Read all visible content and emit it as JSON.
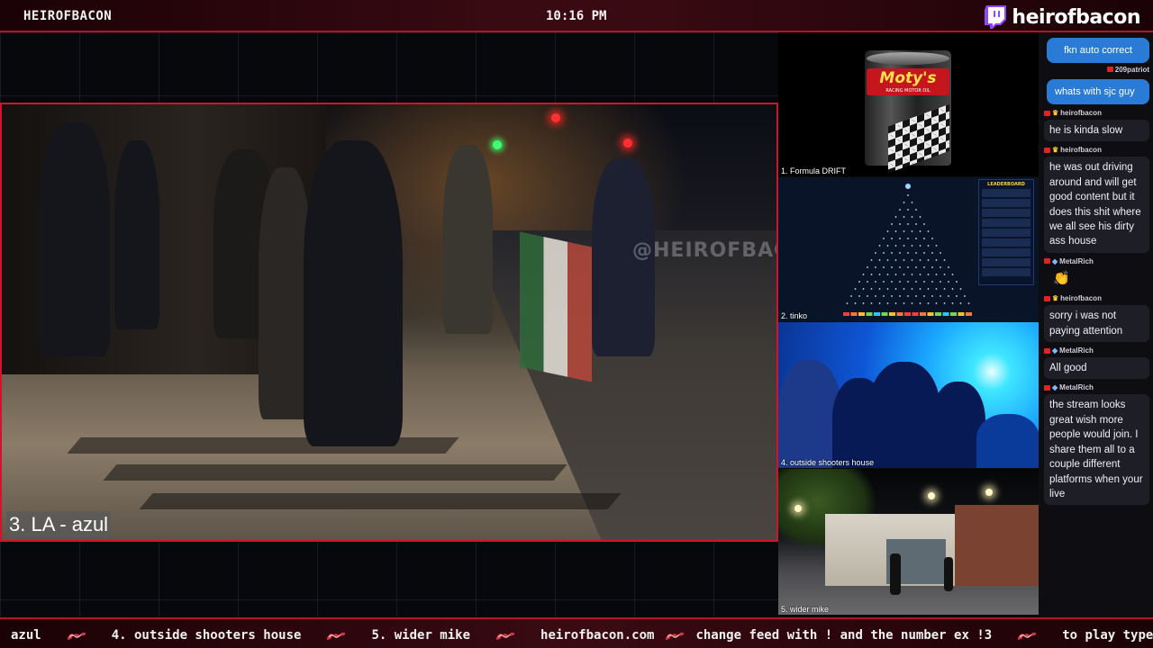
{
  "topbar": {
    "channel": "HEIROFBACON",
    "clock": "10:16 PM",
    "brand": "heirofbacon"
  },
  "main_feed": {
    "label": "3. LA - azul",
    "watermark": "@HEIROFBACON"
  },
  "feeds": [
    {
      "label": "1. Formula DRIFT",
      "oil_brand": "Moty's",
      "oil_sub": "RACING MOTOR OIL"
    },
    {
      "label": "2. tinko",
      "leaderboard_title": "LEADERBOARD"
    },
    {
      "label": "4. outside shooters house"
    },
    {
      "label": "5. wider mike"
    }
  ],
  "chat": {
    "messages": [
      {
        "author": "",
        "text": "fkn auto correct",
        "style": "outgoing"
      },
      {
        "author": "209patriot",
        "text": "",
        "style": "author-only"
      },
      {
        "author": "",
        "text": "whats with sjc guy",
        "style": "outgoing"
      },
      {
        "author": "heirofbacon",
        "text": "he is kinda slow",
        "badge": "crown"
      },
      {
        "author": "heirofbacon",
        "text": "he was out driving around and will get good content but it does this shit where we all see his dirty ass house",
        "badge": "crown"
      },
      {
        "author": "MetalRich",
        "text": "👏",
        "badge": "shield",
        "emoji": true
      },
      {
        "author": "heirofbacon",
        "text": "sorry i was not paying attention",
        "badge": "crown"
      },
      {
        "author": "MetalRich",
        "text": "All good",
        "badge": "shield"
      },
      {
        "author": "MetalRich",
        "text": "the stream looks great wish more people would join. I share them all to a couple different platforms when your live",
        "badge": "shield"
      }
    ]
  },
  "ticker": {
    "items": [
      "azul",
      "4. outside shooters house",
      "5. wider mike",
      "heirofbacon.com",
      "change feed with ! and the number ex !3",
      "to play type"
    ]
  },
  "colors": {
    "accent_red": "#d1142d",
    "chat_blue": "#2a7bd6",
    "twitch_purple": "#9146ff"
  },
  "icons": {
    "brand": "twitch-icon",
    "ticker_separator": "bacon-icon"
  }
}
